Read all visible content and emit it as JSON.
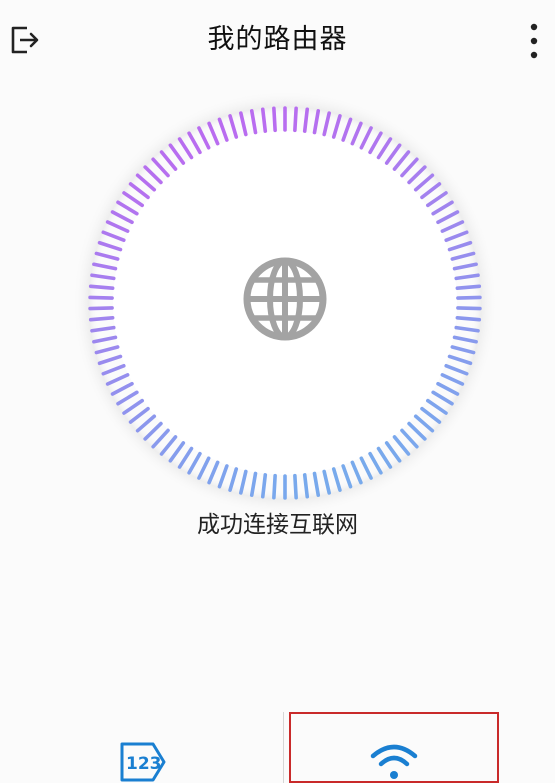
{
  "header": {
    "title": "我的路由器",
    "exit_icon": "exit-icon",
    "more_icon": "more-vertical-icon"
  },
  "dial": {
    "center_icon": "globe-icon",
    "gradient_start": "#c264f0",
    "gradient_end": "#6fb2ec",
    "tick_count": 110
  },
  "status": {
    "text": "成功连接互联网"
  },
  "bottom_nav": {
    "items": [
      {
        "icon": "numeric-123-icon",
        "selected": false
      },
      {
        "icon": "wifi-icon",
        "selected": true
      }
    ],
    "accent_color": "#1a7fd1",
    "highlight_border_color": "#c92a2a"
  }
}
